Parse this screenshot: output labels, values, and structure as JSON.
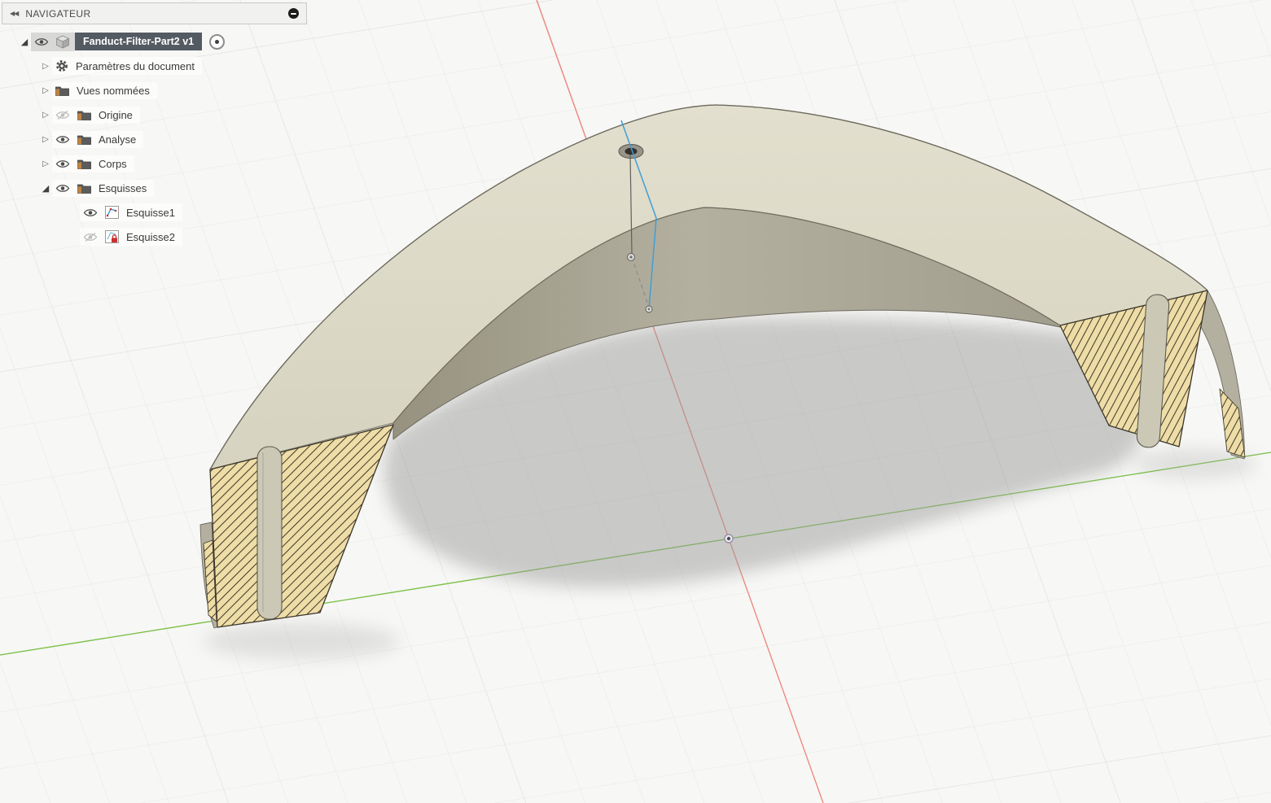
{
  "panel": {
    "collapse_icon": "◀◀",
    "title": "NAVIGATEUR",
    "items": [
      {
        "label": "Fanduct-Filter-Part2 v1",
        "visible": true,
        "active": true
      },
      {
        "label": "Paramètres du document"
      },
      {
        "label": "Vues nommées"
      },
      {
        "label": "Origine",
        "visible": false
      },
      {
        "label": "Analyse",
        "visible": true
      },
      {
        "label": "Corps",
        "visible": true
      },
      {
        "label": "Esquisses",
        "visible": true,
        "expanded": true
      },
      {
        "label": "Esquisse1",
        "visible": true
      },
      {
        "label": "Esquisse2",
        "visible": false,
        "locked": true
      }
    ]
  },
  "icons": {
    "expanded_arrow": "◢",
    "collapsed_arrow": "▷"
  },
  "viewport_colors": {
    "background": "#f7f7f5",
    "grid_line": "#e7e7e5",
    "axis_red": "#ef8379",
    "axis_green": "#77c043",
    "model_top_face": "#dcd9c6",
    "model_inner_wall": "#a9a597",
    "section_hatch_fill": "#eedda6",
    "section_hatch_line": "#433c2e",
    "sketch_blue": "#3f9fd4",
    "shadow": "#9b9b9b"
  }
}
